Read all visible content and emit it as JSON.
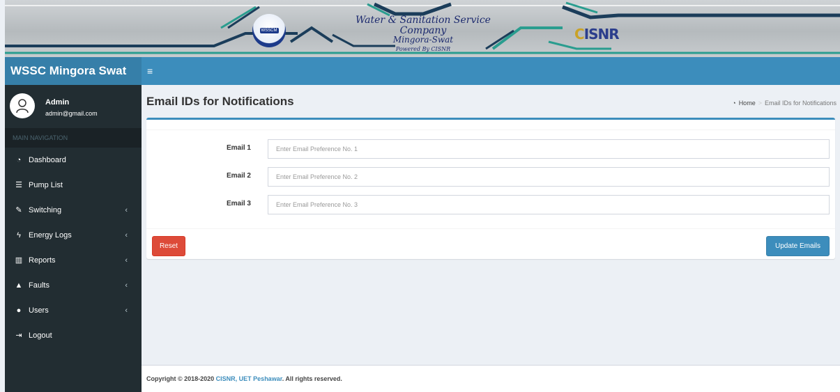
{
  "banner": {
    "title_line1": "Water & Sanitation Service Company",
    "title_line2": "Mingora-Swat",
    "title_line3": "Powered By CISNR",
    "wsscm_logo_text": "WSSCM",
    "cisnr_logo_c": "C",
    "cisnr_logo_rest": "ISNR"
  },
  "navbar": {
    "app_name": "WSSC Mingora Swat",
    "toggle_icon": "hamburger-icon",
    "toggle_glyph": "≡"
  },
  "user": {
    "name": "Admin",
    "email": "admin@gmail.com"
  },
  "sidebar": {
    "header": "MAIN NAVIGATION",
    "items": [
      {
        "label": "Dashboard",
        "icon": "dashboard-icon",
        "glyph": "◔",
        "has_submenu": false
      },
      {
        "label": "Pump List",
        "icon": "list-icon",
        "glyph": "☰",
        "has_submenu": false
      },
      {
        "label": "Switching",
        "icon": "plug-icon",
        "glyph": "✎",
        "has_submenu": true
      },
      {
        "label": "Energy Logs",
        "icon": "bolt-icon",
        "glyph": "ϟ",
        "has_submenu": true
      },
      {
        "label": "Reports",
        "icon": "bar-chart-icon",
        "glyph": "▥",
        "has_submenu": true
      },
      {
        "label": "Faults",
        "icon": "warning-icon",
        "glyph": "▲",
        "has_submenu": true
      },
      {
        "label": "Users",
        "icon": "user-icon",
        "glyph": "●",
        "has_submenu": true
      },
      {
        "label": "Logout",
        "icon": "sign-out-icon",
        "glyph": "⇥",
        "has_submenu": false
      }
    ],
    "chevron_glyph": "‹"
  },
  "content": {
    "page_title": "Email IDs for Notifications",
    "breadcrumb": {
      "home": "Home",
      "separator": ">",
      "current": "Email IDs for Notifications"
    }
  },
  "form": {
    "fields": [
      {
        "label": "Email 1",
        "value": "",
        "placeholder": "Enter Email Preference No. 1"
      },
      {
        "label": "Email 2",
        "value": "",
        "placeholder": "Enter Email Preference No. 2"
      },
      {
        "label": "Email 3",
        "value": "",
        "placeholder": "Enter Email Preference No. 3"
      }
    ],
    "reset_label": "Reset",
    "update_label": "Update Emails"
  },
  "footer": {
    "prefix": "Copyright © 2018-2020 ",
    "link": "CISNR, UET Peshawar",
    "suffix": ". All rights reserved."
  },
  "colors": {
    "primary": "#3c8dbc",
    "danger": "#dd4b39",
    "sidebar_bg": "#222d32"
  }
}
